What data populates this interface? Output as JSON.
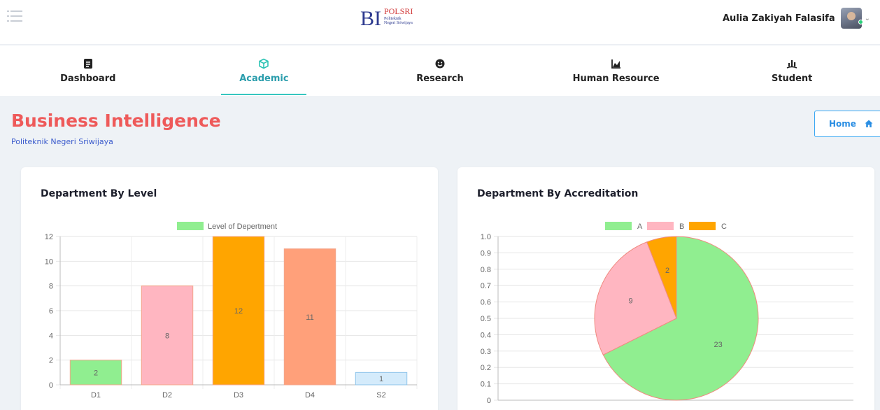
{
  "header": {
    "logo_text": "BI",
    "logo_brand": "POLSRI",
    "logo_sub1": "Politeknik",
    "logo_sub2": "Negeri Sriwijaya",
    "user_name": "Aulia Zakiyah Falasifa"
  },
  "nav": {
    "items": [
      {
        "label": "Dashboard",
        "icon": "document-icon",
        "active": false
      },
      {
        "label": "Academic",
        "icon": "cube-icon",
        "active": true
      },
      {
        "label": "Research",
        "icon": "smiley-icon",
        "active": false
      },
      {
        "label": "Human Resource",
        "icon": "area-chart-icon",
        "active": false
      },
      {
        "label": "Student",
        "icon": "bar-chart-icon",
        "active": false
      }
    ]
  },
  "page": {
    "title": "Business Intelligence",
    "subtitle": "Politeknik Negeri Sriwijaya",
    "home_label": "Home"
  },
  "colors": {
    "title_red": "#ee5a5a",
    "accent_teal": "#2a9dac",
    "home_blue": "#2a8ee3",
    "green": "#90ee90",
    "pink": "#ffb6c1",
    "orange": "#ffa500",
    "salmon": "#ffa07a",
    "lightblue": "#d4ebfb"
  },
  "chart_data": [
    {
      "type": "bar",
      "title": "Department By Level",
      "series": [
        {
          "name": "Level of Depertment",
          "values": [
            2,
            8,
            12,
            11,
            1
          ]
        }
      ],
      "categories": [
        "D1",
        "D2",
        "D3",
        "D4",
        "S2"
      ],
      "colors": [
        "#90ee90",
        "#ffb6c1",
        "#ffa500",
        "#ffa07a",
        "#d4ebfb"
      ],
      "ylim": [
        0,
        12
      ],
      "yticks": [
        "0",
        "2",
        "4",
        "6",
        "8",
        "10",
        "12"
      ],
      "grid": true,
      "legend": "top"
    },
    {
      "type": "pie",
      "title": "Department By Accreditation",
      "categories": [
        "A",
        "B",
        "C"
      ],
      "values": [
        23,
        9,
        2
      ],
      "colors": [
        "#90ee90",
        "#ffb6c1",
        "#ffa500"
      ],
      "ylim": [
        0,
        1
      ],
      "yticks": [
        "0",
        "0.1",
        "0.2",
        "0.3",
        "0.4",
        "0.5",
        "0.6",
        "0.7",
        "0.8",
        "0.9",
        "1.0"
      ],
      "grid": true,
      "legend": "top"
    }
  ]
}
